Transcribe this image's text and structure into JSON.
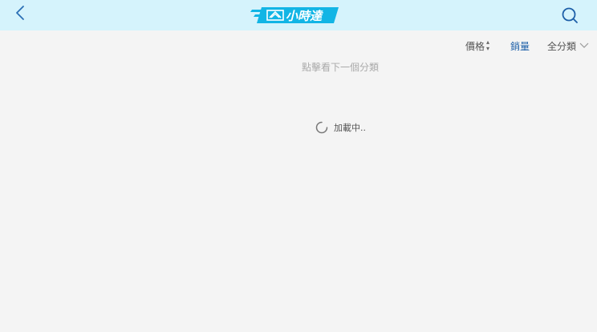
{
  "header": {
    "logo_text": "小時達",
    "bg_color": "#d5f3fc",
    "logo_color": "#12b5e5",
    "back_icon": "chevron-left-icon",
    "search_icon": "search-icon"
  },
  "sort_bar": {
    "price_label": "價格",
    "sales_label": "銷量",
    "category_label": "全分類",
    "active_color": "#1d5fa8"
  },
  "next_category_text": "點擊看下一個分類",
  "loading_text": "加載中.."
}
